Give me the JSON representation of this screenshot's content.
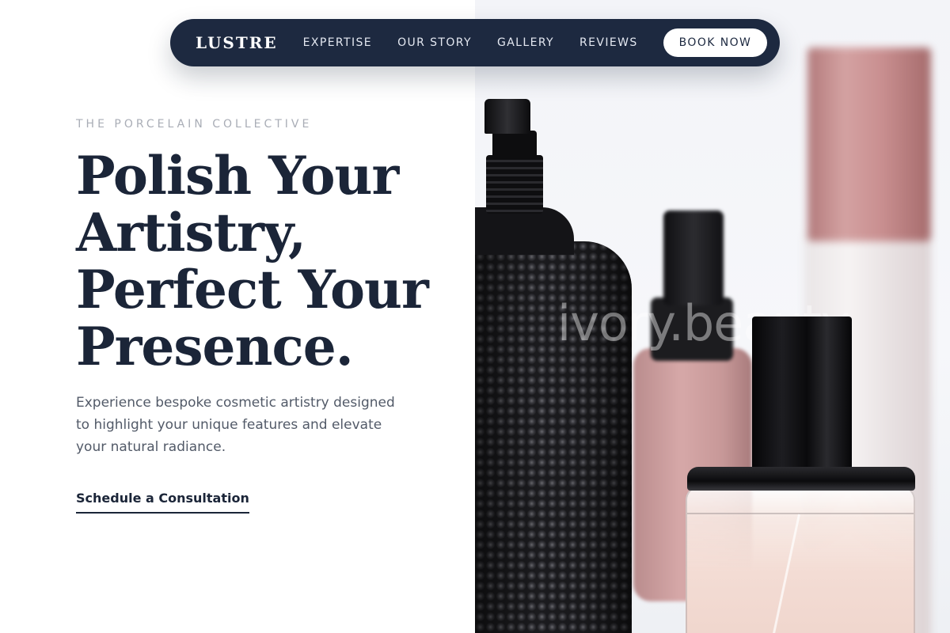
{
  "nav": {
    "brand": "LUSTRE",
    "links": [
      {
        "label": "EXPERTISE"
      },
      {
        "label": "OUR STORY"
      },
      {
        "label": "GALLERY"
      },
      {
        "label": "REVIEWS"
      }
    ],
    "cta_label": "BOOK NOW"
  },
  "hero": {
    "eyebrow": "THE PORCELAIN COLLECTIVE",
    "headline_lines": [
      "Polish Your",
      "Artistry,",
      "Perfect Your",
      "Presence."
    ],
    "subcopy": "Experience bespoke cosmetic artistry designed to highlight your unique features and elevate your natural radiance.",
    "cta_label": "Schedule a Consultation",
    "photo_watermark": "ivory.beauty"
  },
  "colors": {
    "nav_background": "#1d2940",
    "headline": "#1b2538",
    "body_text": "#525a68",
    "eyebrow": "#a9adb6",
    "accent_pink": "#d4a2a2"
  }
}
